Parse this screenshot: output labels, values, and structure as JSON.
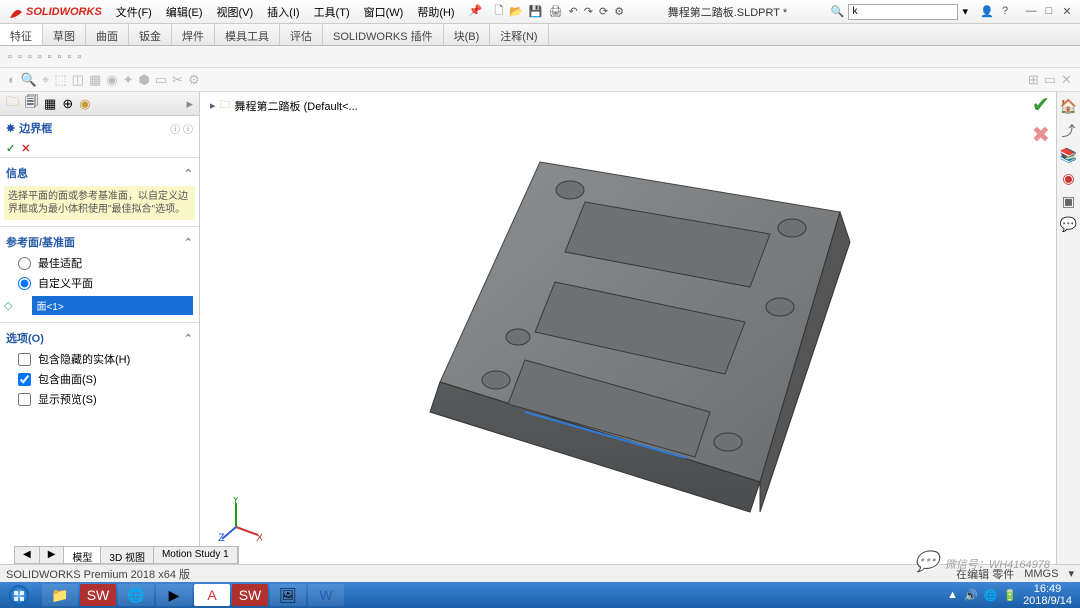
{
  "app": {
    "name": "SOLIDWORKS",
    "doc_title": "舞程第二踏板.SLDPRT *"
  },
  "menus": [
    "文件(F)",
    "编辑(E)",
    "视图(V)",
    "插入(I)",
    "工具(T)",
    "窗口(W)",
    "帮助(H)"
  ],
  "search": {
    "placeholder": "",
    "value": "k"
  },
  "ribbon_tabs": [
    "特征",
    "草图",
    "曲面",
    "钣金",
    "焊件",
    "模具工具",
    "评估",
    "SOLIDWORKS 插件",
    "块(B)",
    "注释(N)"
  ],
  "tree": {
    "root": "舞程第二踏板 (Default<..."
  },
  "panel": {
    "title": "边界框",
    "info_hdr": "信息",
    "info_text": "选择平面的面或参考基准面，以自定义边界框或为最小体积使用\"最佳拟合\"选项。",
    "ref_hdr": "参考面/基准面",
    "opt1": "最佳适配",
    "opt2": "自定义平面",
    "sel": "面<1>",
    "opts_hdr": "选项(O)",
    "chk1": "包含隐藏的实体(H)",
    "chk2": "包含曲面(S)",
    "chk3": "显示预览(S)"
  },
  "bottom_tabs": [
    "◀",
    "▶",
    "模型",
    "3D 视图",
    "Motion Study 1"
  ],
  "status": {
    "left": "SOLIDWORKS Premium 2018 x64 版",
    "right": "在编辑 零件",
    "units": "MMGS"
  },
  "taskbar": {
    "time": "16:49",
    "date": "2018/9/14"
  },
  "watermark": "微信号：WH4164978"
}
